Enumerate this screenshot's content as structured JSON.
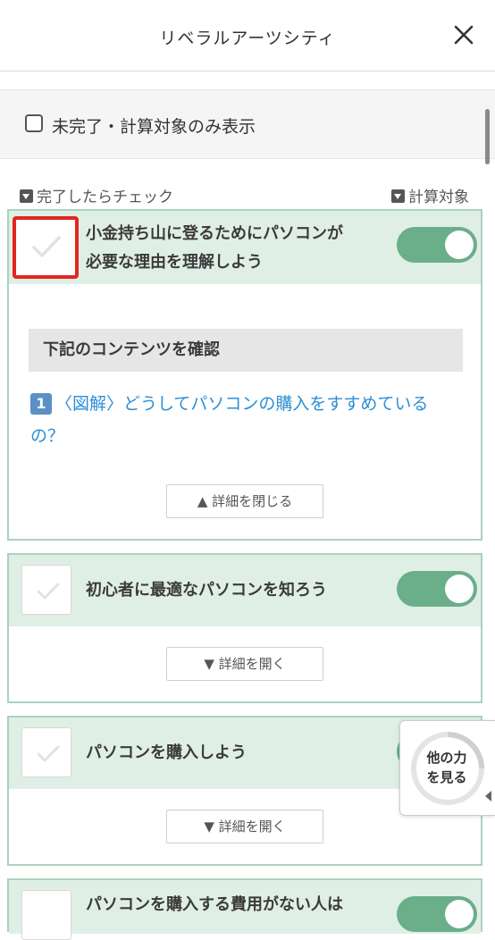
{
  "header": {
    "title": "リベラルアーツシティ",
    "close_icon": "close-icon"
  },
  "filter": {
    "checkbox_label": "未完了・計算対象のみ表示",
    "checked": false
  },
  "legend": {
    "left": "完了したらチェック",
    "right": "計算対象"
  },
  "tasks": [
    {
      "title_line1": "小金持ち山に登るためにパソコンが",
      "title_line2": "必要な理由を理解しよう",
      "completed": false,
      "counted": true,
      "section_header": "下記のコンテンツを確認",
      "link_number": "1",
      "link_text": "〈図解〉どうしてパソコンの購入をすすめているの？",
      "toggle_button": "▲ 詳細を閉じる"
    },
    {
      "title": "初心者に最適なパソコンを知ろう",
      "completed": false,
      "counted": true,
      "toggle_button": "▼ 詳細を開く"
    },
    {
      "title": "パソコンを購入しよう",
      "completed": false,
      "counted": true,
      "toggle_button": "▼ 詳細を開く"
    },
    {
      "title": "パソコンを購入する費用がない人は",
      "completed": false,
      "counted": true
    }
  ],
  "floating_widget": {
    "label_line1": "他の力",
    "label_line2": "を見る"
  },
  "colors": {
    "accent_green": "#6aae8a",
    "card_head_bg": "#e0efe6",
    "card_border": "#a9d3bd",
    "link_blue": "#2d8fd5",
    "highlight_red": "#e0281e"
  }
}
